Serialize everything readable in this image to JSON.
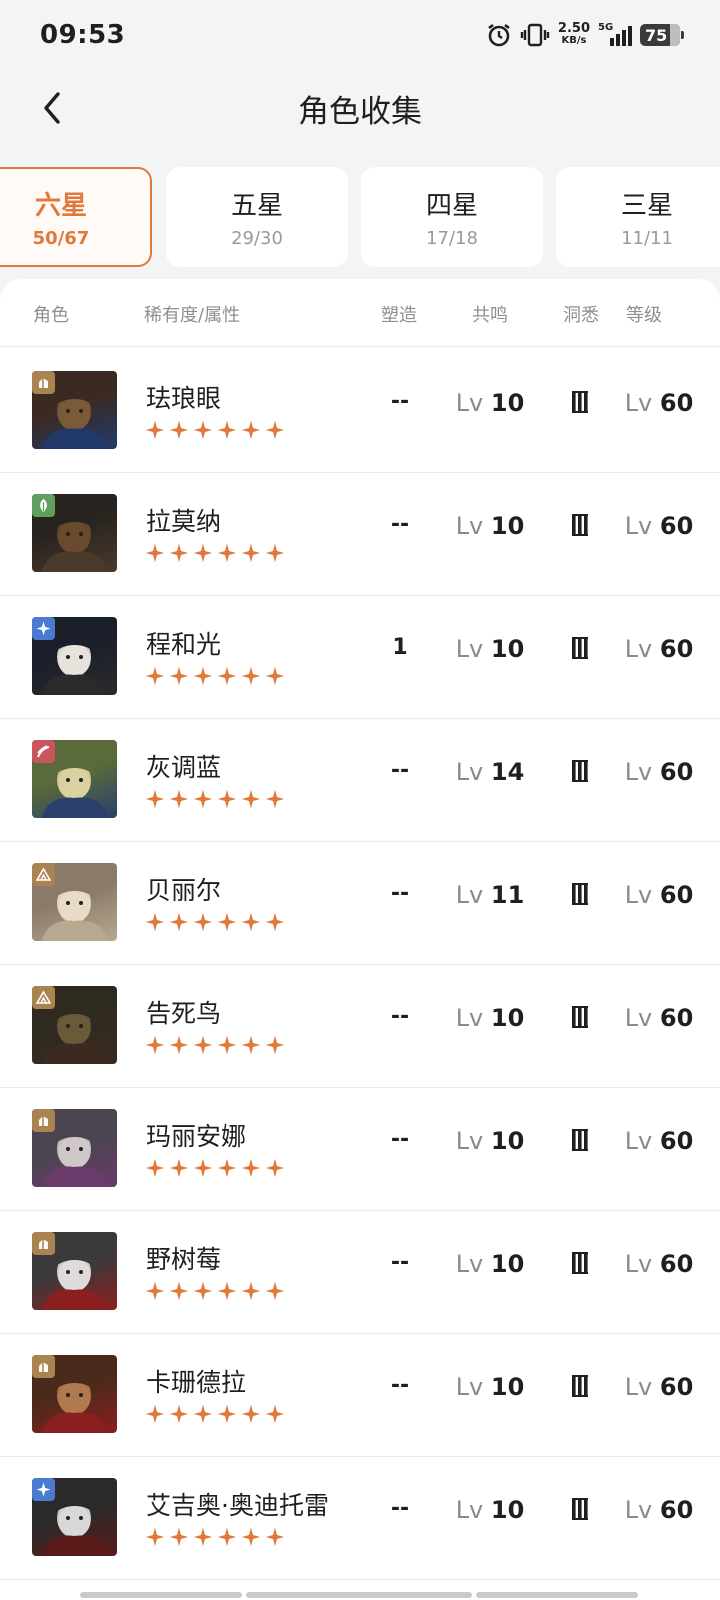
{
  "status_bar": {
    "time": "09:53",
    "net_speed_value": "2.50",
    "net_speed_unit": "KB/s",
    "network": "5G",
    "battery": "75",
    "icons": [
      "alarm-icon",
      "vibrate-icon",
      "signal-icon",
      "battery-icon"
    ]
  },
  "header": {
    "title": "角色收集",
    "back_icon": "chevron-left-icon"
  },
  "tabs": [
    {
      "label": "六星",
      "count": "50/67",
      "active": true
    },
    {
      "label": "五星",
      "count": "29/30",
      "active": false
    },
    {
      "label": "四星",
      "count": "17/18",
      "active": false
    },
    {
      "label": "三星",
      "count": "11/11",
      "active": false
    }
  ],
  "columns": {
    "character": "角色",
    "rarity_attr": "稀有度/属性",
    "shape": "塑造",
    "resonance": "共鸣",
    "insight": "洞悉",
    "level": "等级"
  },
  "colors": {
    "accent": "#e07a3c",
    "attr_mineral": "#a98350",
    "attr_plant": "#5fa05f",
    "attr_astral": "#4a7bd0",
    "attr_beast": "#c8565a"
  },
  "characters": [
    {
      "name": "珐琅眼",
      "stars": 6,
      "attr": "mineral",
      "shape": "--",
      "lv_prefix": "Lv",
      "resonance": "10",
      "insight": "Ⅲ",
      "level": "60"
    },
    {
      "name": "拉莫纳",
      "stars": 6,
      "attr": "plant",
      "shape": "--",
      "lv_prefix": "Lv",
      "resonance": "10",
      "insight": "Ⅲ",
      "level": "60"
    },
    {
      "name": "程和光",
      "stars": 6,
      "attr": "astral",
      "shape": "1",
      "lv_prefix": "Lv",
      "resonance": "10",
      "insight": "Ⅲ",
      "level": "60"
    },
    {
      "name": "灰调蓝",
      "stars": 6,
      "attr": "beast",
      "shape": "--",
      "lv_prefix": "Lv",
      "resonance": "14",
      "insight": "Ⅲ",
      "level": "60"
    },
    {
      "name": "贝丽尔",
      "stars": 6,
      "attr": "mineral2",
      "shape": "--",
      "lv_prefix": "Lv",
      "resonance": "11",
      "insight": "Ⅲ",
      "level": "60"
    },
    {
      "name": "告死鸟",
      "stars": 6,
      "attr": "mineral2",
      "shape": "--",
      "lv_prefix": "Lv",
      "resonance": "10",
      "insight": "Ⅲ",
      "level": "60"
    },
    {
      "name": "玛丽安娜",
      "stars": 6,
      "attr": "mineral",
      "shape": "--",
      "lv_prefix": "Lv",
      "resonance": "10",
      "insight": "Ⅲ",
      "level": "60"
    },
    {
      "name": "野树莓",
      "stars": 6,
      "attr": "mineral",
      "shape": "--",
      "lv_prefix": "Lv",
      "resonance": "10",
      "insight": "Ⅲ",
      "level": "60"
    },
    {
      "name": "卡珊德拉",
      "stars": 6,
      "attr": "mineral",
      "shape": "--",
      "lv_prefix": "Lv",
      "resonance": "10",
      "insight": "Ⅲ",
      "level": "60"
    },
    {
      "name": "艾吉奥·奥迪托雷",
      "stars": 6,
      "attr": "astral",
      "shape": "--",
      "lv_prefix": "Lv",
      "resonance": "10",
      "insight": "Ⅲ",
      "level": "60"
    }
  ]
}
